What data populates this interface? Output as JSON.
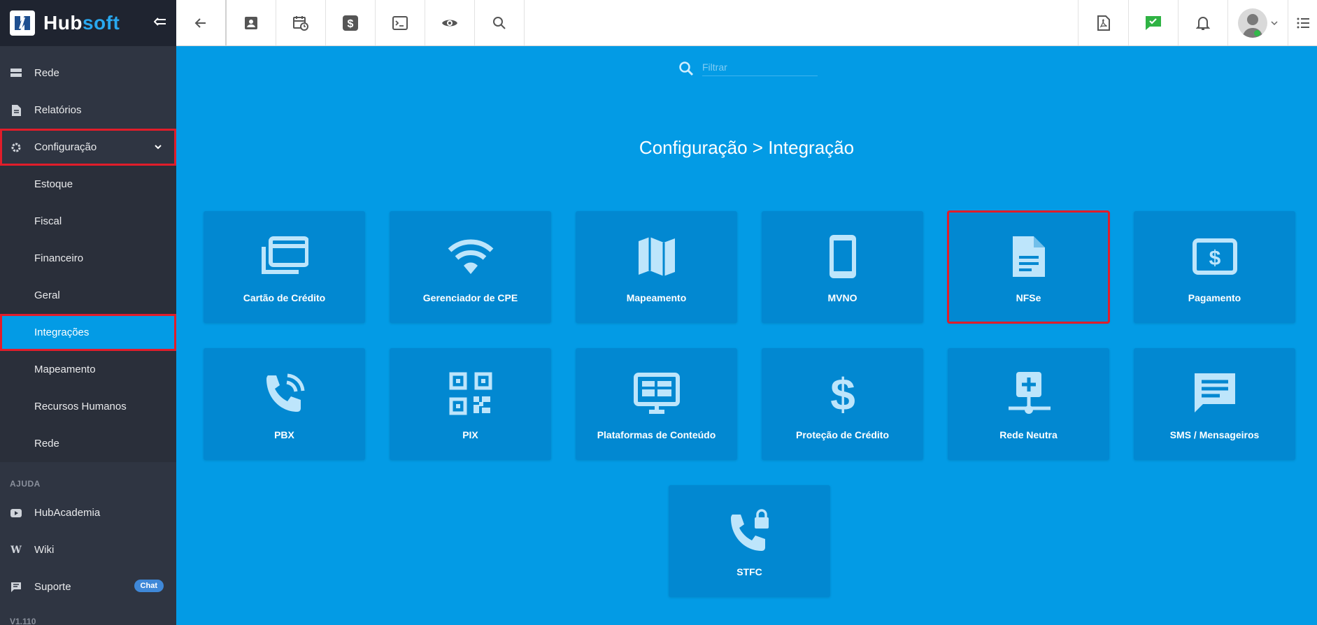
{
  "brand": {
    "name_part1": "Hub",
    "name_part2": "soft"
  },
  "sidebar": {
    "items": [
      {
        "label": "Rede"
      },
      {
        "label": "Relatórios"
      },
      {
        "label": "Configuração"
      }
    ],
    "submenu": [
      {
        "label": "Estoque"
      },
      {
        "label": "Fiscal"
      },
      {
        "label": "Financeiro"
      },
      {
        "label": "Geral"
      },
      {
        "label": "Integrações"
      },
      {
        "label": "Mapeamento"
      },
      {
        "label": "Recursos Humanos"
      },
      {
        "label": "Rede"
      }
    ],
    "help_section": "AJUDA",
    "help_items": [
      {
        "label": "HubAcademia"
      },
      {
        "label": "Wiki"
      },
      {
        "label": "Suporte"
      }
    ],
    "chat_badge": "Chat",
    "version": "V1.110"
  },
  "filter": {
    "placeholder": "Filtrar"
  },
  "page_title": "Configuração > Integração",
  "cards": [
    {
      "label": "Cartão de Crédito",
      "icon": "credit-cards-icon"
    },
    {
      "label": "Gerenciador de CPE",
      "icon": "wifi-icon"
    },
    {
      "label": "Mapeamento",
      "icon": "map-icon"
    },
    {
      "label": "MVNO",
      "icon": "smartphone-icon"
    },
    {
      "label": "NFSe",
      "icon": "document-icon"
    },
    {
      "label": "Pagamento",
      "icon": "payment-icon"
    },
    {
      "label": "PBX",
      "icon": "phone-call-icon"
    },
    {
      "label": "PIX",
      "icon": "qr-code-icon"
    },
    {
      "label": "Plataformas de Conteúdo",
      "icon": "monitor-content-icon"
    },
    {
      "label": "Proteção de Crédito",
      "icon": "dollar-icon"
    },
    {
      "label": "Rede Neutra",
      "icon": "network-node-icon"
    },
    {
      "label": "SMS / Mensageiros",
      "icon": "message-icon"
    },
    {
      "label": "STFC",
      "icon": "phone-lock-icon"
    }
  ],
  "colors": {
    "accent": "#039be5",
    "card": "#0288d1",
    "sidebar": "#2f3542",
    "highlight": "#e11d2a"
  }
}
